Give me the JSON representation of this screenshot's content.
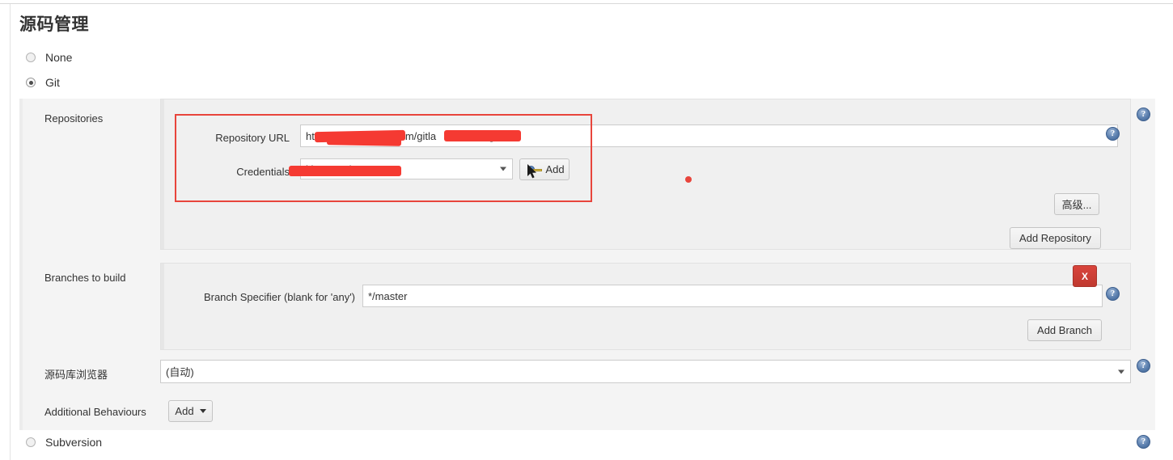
{
  "page": {
    "title": "源码管理"
  },
  "scm_options": [
    {
      "label": "None",
      "checked": false
    },
    {
      "label": "Git",
      "checked": true
    },
    {
      "label": "Subversion",
      "checked": false
    }
  ],
  "git": {
    "repositories": {
      "label": "Repositories",
      "repository_url": {
        "label": "Repository URL",
        "value": "https://rde                om/gitla                t.git"
      },
      "credentials": {
        "label": "Credentials",
        "value": "j                      ina.com/******",
        "add_button": "Add",
        "add_icon": "key-icon"
      },
      "advanced_button": "高级...",
      "add_repository_button": "Add Repository"
    },
    "branches": {
      "label": "Branches to build",
      "branch_specifier": {
        "label": "Branch Specifier (blank for 'any')",
        "value": "*/master"
      },
      "delete_button": "X",
      "add_branch_button": "Add Branch"
    },
    "repo_browser": {
      "label": "源码库浏览器",
      "value": "(自动)"
    },
    "additional_behaviours": {
      "label": "Additional Behaviours",
      "add_button": "Add"
    }
  },
  "help_icon": "help-icon",
  "colors": {
    "annotation_red": "#e8453c",
    "redaction_red": "#f53a32",
    "delete_red": "#c0392f",
    "help_blue": "#3f6493",
    "panel_grey": "#f4f4f4"
  }
}
